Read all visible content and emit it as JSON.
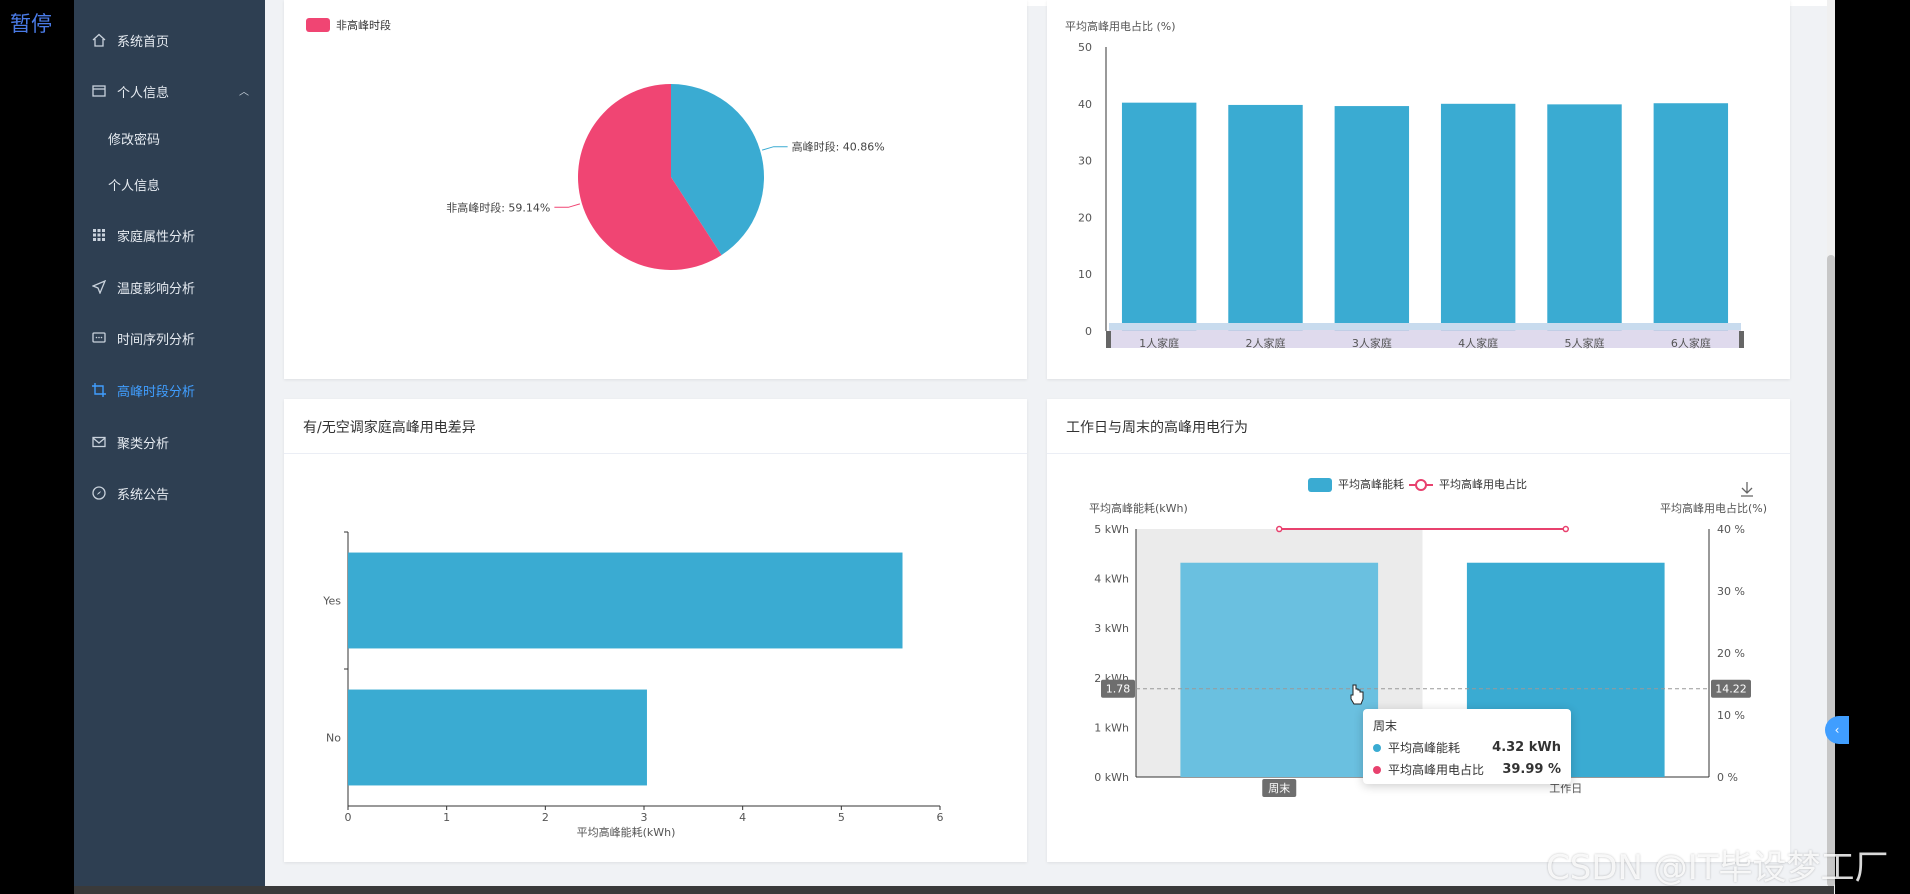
{
  "overlay": {
    "pause_label": "暂停",
    "watermark": "CSDN @IT毕设梦工厂"
  },
  "sidebar": {
    "items": [
      {
        "label": "系统首页",
        "icon": "home-icon"
      },
      {
        "label": "个人信息",
        "icon": "user-card-icon",
        "expanded": true
      },
      {
        "label": "修改密码",
        "sub": true
      },
      {
        "label": "个人信息",
        "sub": true
      },
      {
        "label": "家庭属性分析",
        "icon": "grid-icon"
      },
      {
        "label": "温度影响分析",
        "icon": "send-icon"
      },
      {
        "label": "时间序列分析",
        "icon": "chat-icon"
      },
      {
        "label": "高峰时段分析",
        "icon": "crop-icon",
        "active": true
      },
      {
        "label": "聚类分析",
        "icon": "mail-icon"
      },
      {
        "label": "系统公告",
        "icon": "compass-icon"
      }
    ],
    "active_color": "#409eff"
  },
  "cards": {
    "pie": {
      "title": ""
    },
    "bar_household": {
      "title": ""
    },
    "ac_diff": {
      "title": "有/无空调家庭高峰用电差异"
    },
    "weekday_weekend": {
      "title": "工作日与周末的高峰用电行为"
    }
  },
  "tooltip": {
    "title": "周末",
    "rows": [
      {
        "name": "平均高峰能耗",
        "value": "4.32 kWh",
        "color": "#3aabd2"
      },
      {
        "name": "平均高峰用电占比",
        "value": "39.99 %",
        "color": "#e8416e"
      }
    ]
  },
  "chart_data": [
    {
      "type": "pie",
      "legend": [
        "非高峰时段"
      ],
      "slices": [
        {
          "name": "高峰时段",
          "value": 40.86,
          "label": "高峰时段: 40.86%",
          "color": "#3aabd2"
        },
        {
          "name": "非高峰时段",
          "value": 59.14,
          "label": "非高峰时段: 59.14%",
          "color": "#f04573"
        }
      ]
    },
    {
      "type": "bar",
      "ylabel": "平均高峰用电占比 (%)",
      "categories": [
        "1人家庭",
        "2人家庭",
        "3人家庭",
        "4人家庭",
        "5人家庭",
        "6人家庭"
      ],
      "values": [
        40.2,
        39.8,
        39.6,
        40.0,
        39.9,
        40.1
      ],
      "ylim": [
        0,
        50
      ],
      "yticks": [
        "0",
        "10",
        "20",
        "30",
        "40",
        "50"
      ],
      "color": "#3aabd2",
      "datazoom": true
    },
    {
      "type": "bar",
      "orientation": "horizontal",
      "categories": [
        "Yes",
        "No"
      ],
      "values": [
        5.62,
        3.03
      ],
      "xlabel": "平均高峰能耗(kWh)",
      "xlim": [
        0,
        6
      ],
      "xticks": [
        "0",
        "1",
        "2",
        "3",
        "4",
        "5",
        "6"
      ],
      "color": "#3aabd2"
    },
    {
      "type": "bar",
      "categories": [
        "周末",
        "工作日"
      ],
      "series": [
        {
          "name": "平均高峰能耗",
          "type": "bar",
          "values": [
            4.32,
            4.32
          ],
          "color": "#3aabd2",
          "axis": "left"
        },
        {
          "name": "平均高峰用电占比",
          "type": "line",
          "values": [
            39.99,
            39.99
          ],
          "color": "#e8416e",
          "axis": "right"
        }
      ],
      "ylabel_left": "平均高峰能耗(kWh)",
      "ylabel_right": "平均高峰用电占比(%)",
      "ylim_left": [
        0,
        5
      ],
      "ylim_right": [
        0,
        40
      ],
      "yticks_left": [
        "0 kWh",
        "1 kWh",
        "2 kWh",
        "3 kWh",
        "4 kWh",
        "5 kWh"
      ],
      "yticks_right": [
        "0 %",
        "10 %",
        "20 %",
        "30 %",
        "40 %"
      ],
      "pointer": {
        "left_value": "1.78",
        "right_value": "14.22",
        "category": "周末"
      },
      "highlight_category": "周末"
    }
  ]
}
